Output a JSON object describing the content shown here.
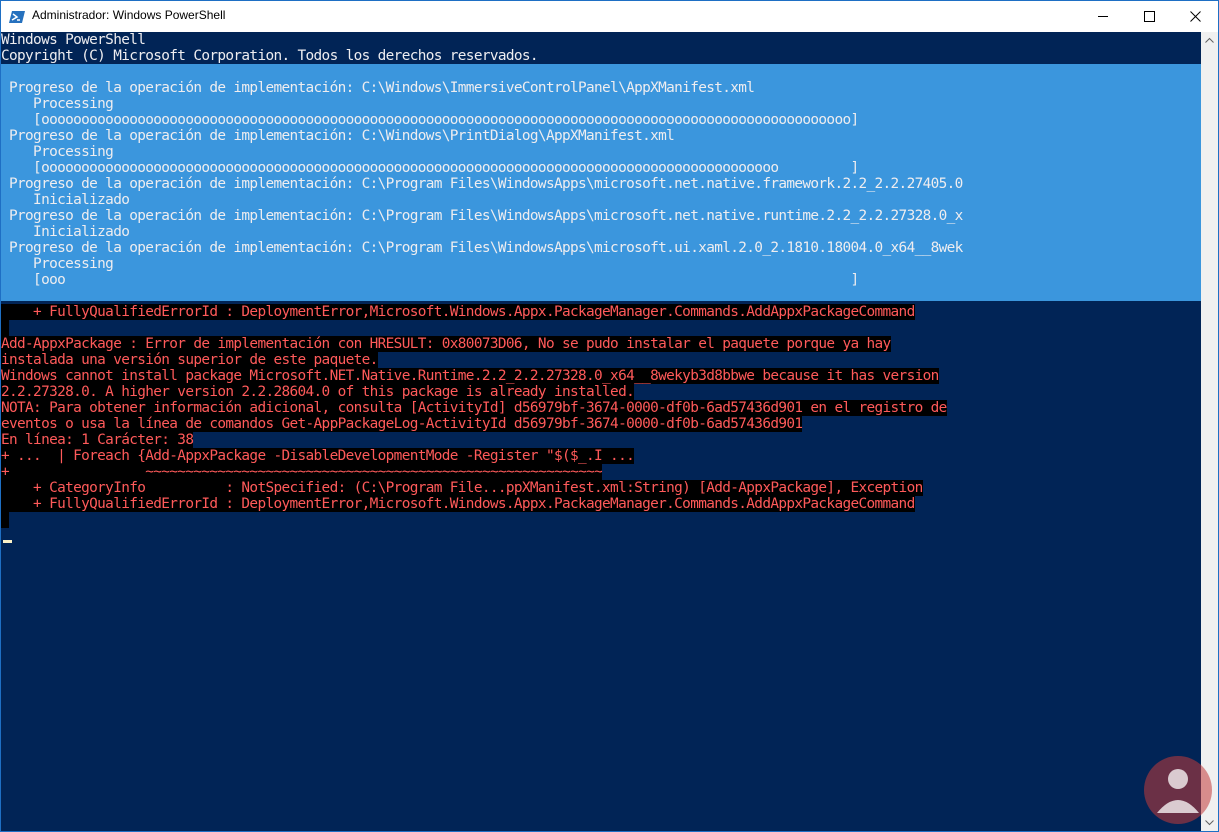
{
  "window": {
    "title": "Administrador: Windows PowerShell",
    "minimize_label": "minimize",
    "maximize_label": "maximize",
    "close_label": "close"
  },
  "console": {
    "header_lines": [
      "Windows PowerShell",
      "Copyright (C) Microsoft Corporation. Todos los derechos reservados."
    ],
    "progress_lines": [
      " Progreso de la operación de implementación: C:\\Windows\\ImmersiveControlPanel\\AppXManifest.xml",
      "    Processing",
      "    [ooooooooooooooooooooooooooooooooooooooooooooooooooooooooooooooooooooooooooooooooooooooooooooooooooooo]",
      " Progreso de la operación de implementación: C:\\Windows\\PrintDialog\\AppXManifest.xml",
      "    Processing",
      "    [oooooooooooooooooooooooooooooooooooooooooooooooooooooooooooooooooooooooooooooooooooooooooooo         ]",
      " Progreso de la operación de implementación: C:\\Program Files\\WindowsApps\\microsoft.net.native.framework.2.2_2.2.27405.0",
      "    Inicializado",
      " Progreso de la operación de implementación: C:\\Program Files\\WindowsApps\\microsoft.net.native.runtime.2.2_2.2.27328.0_x",
      "    Inicializado",
      " Progreso de la operación de implementación: C:\\Program Files\\WindowsApps\\microsoft.ui.xaml.2.0_2.1810.18004.0_x64__8wek",
      "    Processing",
      "    [ooo                                                                                                  ]"
    ],
    "error_lines_top": [
      "    + FullyQualifiedErrorId : DeploymentError,Microsoft.Windows.Appx.PackageManager.Commands.AddAppxPackageCommand",
      " "
    ],
    "error_lines": [
      "Add-AppxPackage : Error de implementación con HRESULT: 0x80073D06, No se pudo instalar el paquete porque ya hay",
      "instalada una versión superior de este paquete.",
      "Windows cannot install package Microsoft.NET.Native.Runtime.2.2_2.2.27328.0_x64__8wekyb3d8bbwe because it has version",
      "2.2.27328.0. A higher version 2.2.28604.0 of this package is already installed.",
      "NOTA: Para obtener información adicional, consulta [ActivityId] d56979bf-3674-0000-df0b-6ad57436d901 en el registro de",
      "eventos o usa la línea de comandos Get-AppPackageLog-ActivityId d56979bf-3674-0000-df0b-6ad57436d901",
      "En línea: 1 Carácter: 38",
      "+ ...  | Foreach {Add-AppxPackage -DisableDevelopmentMode -Register \"$($_.I ...",
      "+                 ~~~~~~~~~~~~~~~~~~~~~~~~~~~~~~~~~~~~~~~~~~~~~~~~~~~~~~~~~",
      "    + CategoryInfo          : NotSpecified: (C:\\Program File...ppXManifest.xml:String) [Add-AppxPackage], Exception",
      "    + FullyQualifiedErrorId : DeploymentError,Microsoft.Windows.Appx.PackageManager.Commands.AddAppxPackageCommand",
      " "
    ]
  },
  "colors": {
    "console_bg": "#012456",
    "progress_bg": "#3b96dd",
    "error_fg": "#ff5a5a",
    "error_bg": "#000000",
    "text_fg": "#eeedf0"
  },
  "icons": {
    "app": "powershell-icon",
    "minimize": "minimize-icon",
    "maximize": "maximize-icon",
    "close": "close-icon",
    "watermark": "watermark-logo"
  }
}
